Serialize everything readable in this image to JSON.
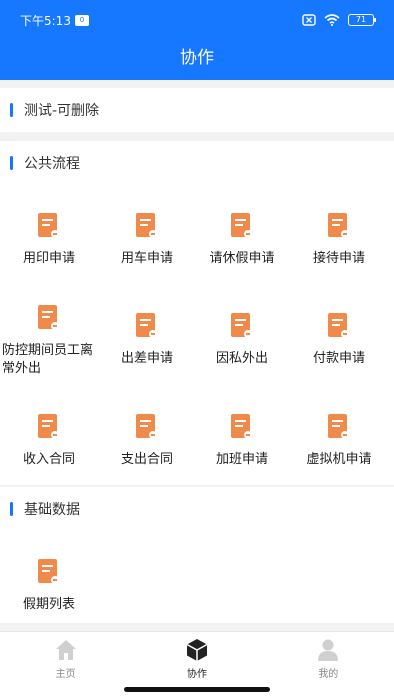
{
  "status_bar": {
    "time": "下午5:13",
    "badge": "0",
    "battery": "71"
  },
  "header": {
    "title": "协作"
  },
  "sections": {
    "test": {
      "title": "测试-可删除"
    },
    "public": {
      "title": "公共流程",
      "items": [
        {
          "label": "用印申请"
        },
        {
          "label": "用车申请"
        },
        {
          "label": "请休假申请"
        },
        {
          "label": "接待申请"
        },
        {
          "label": "防控期间员工离常外出"
        },
        {
          "label": "出差申请"
        },
        {
          "label": "因私外出"
        },
        {
          "label": "付款申请"
        },
        {
          "label": "收入合同"
        },
        {
          "label": "支出合同"
        },
        {
          "label": "加班申请"
        },
        {
          "label": "虚拟机申请"
        }
      ]
    },
    "basic": {
      "title": "基础数据",
      "items": [
        {
          "label": "假期列表"
        }
      ]
    }
  },
  "tabbar": {
    "items": [
      {
        "label": "主页",
        "icon": "home-icon"
      },
      {
        "label": "协作",
        "icon": "cube-icon"
      },
      {
        "label": "我的",
        "icon": "user-icon"
      }
    ]
  },
  "colors": {
    "primary": "#1677ff",
    "icon_orange": "#f08a4b"
  }
}
